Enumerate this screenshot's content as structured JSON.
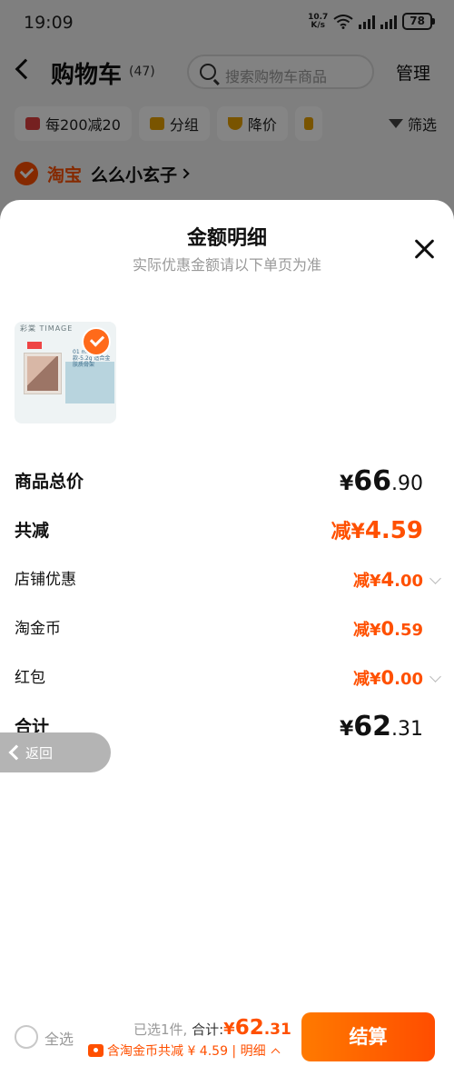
{
  "status_bar": {
    "time": "19:09",
    "net_speed_value": "10.7",
    "net_speed_unit": "K/s",
    "battery": "78"
  },
  "cart_header": {
    "title": "购物车",
    "count": "(47)",
    "search_placeholder": "搜索购物车商品",
    "manage_label": "管理"
  },
  "filter_chips": [
    {
      "label": "每200减20",
      "icon": "shop-icon",
      "color": "#e04040"
    },
    {
      "label": "分组",
      "icon": "folder-icon",
      "color": "#e8a200"
    },
    {
      "label": "降价",
      "icon": "down-arrow-icon",
      "color": "#e8a200"
    },
    {
      "label": "",
      "icon": "hand-icon",
      "color": "#e8a200"
    }
  ],
  "filter_label": "筛选",
  "shop": {
    "brand": "淘宝",
    "name": "么么小玄子"
  },
  "sheet": {
    "title": "金额明细",
    "subtitle": "实际优惠金额请以下单页为准"
  },
  "product": {
    "brand_text": "彩棠 TIMAGE",
    "badge_text": "01 mini款-5.2g 适合金肤质骨架"
  },
  "details": {
    "goods_total": {
      "label": "商品总价",
      "yen": "¥",
      "int": "66",
      "dec": ".90"
    },
    "total_reduce": {
      "label": "共减",
      "prefix": "减¥",
      "value": "4.59"
    },
    "shop_discount": {
      "label": "店铺优惠",
      "prefix": "减¥",
      "int": "4",
      "dec": ".00"
    },
    "tao_coin": {
      "label": "淘金币",
      "prefix": "减¥",
      "int": "0",
      "dec": ".59"
    },
    "red_packet": {
      "label": "红包",
      "prefix": "减¥",
      "int": "0",
      "dec": ".00"
    },
    "grand_total": {
      "label": "合计",
      "yen": "¥",
      "int": "62",
      "dec": ".31"
    }
  },
  "float_back": {
    "label": "返回"
  },
  "bottom_bar": {
    "select_all": "全选",
    "selected_text": "已选1件,",
    "total_label": "合计:",
    "total_yen": "¥",
    "total_int": "62",
    "total_dec": ".31",
    "coin_text": "含淘金币共减 ¥ 4.59 | 明细",
    "checkout_label": "结算"
  },
  "colors": {
    "accent": "#ff5000",
    "muted": "#999999"
  }
}
